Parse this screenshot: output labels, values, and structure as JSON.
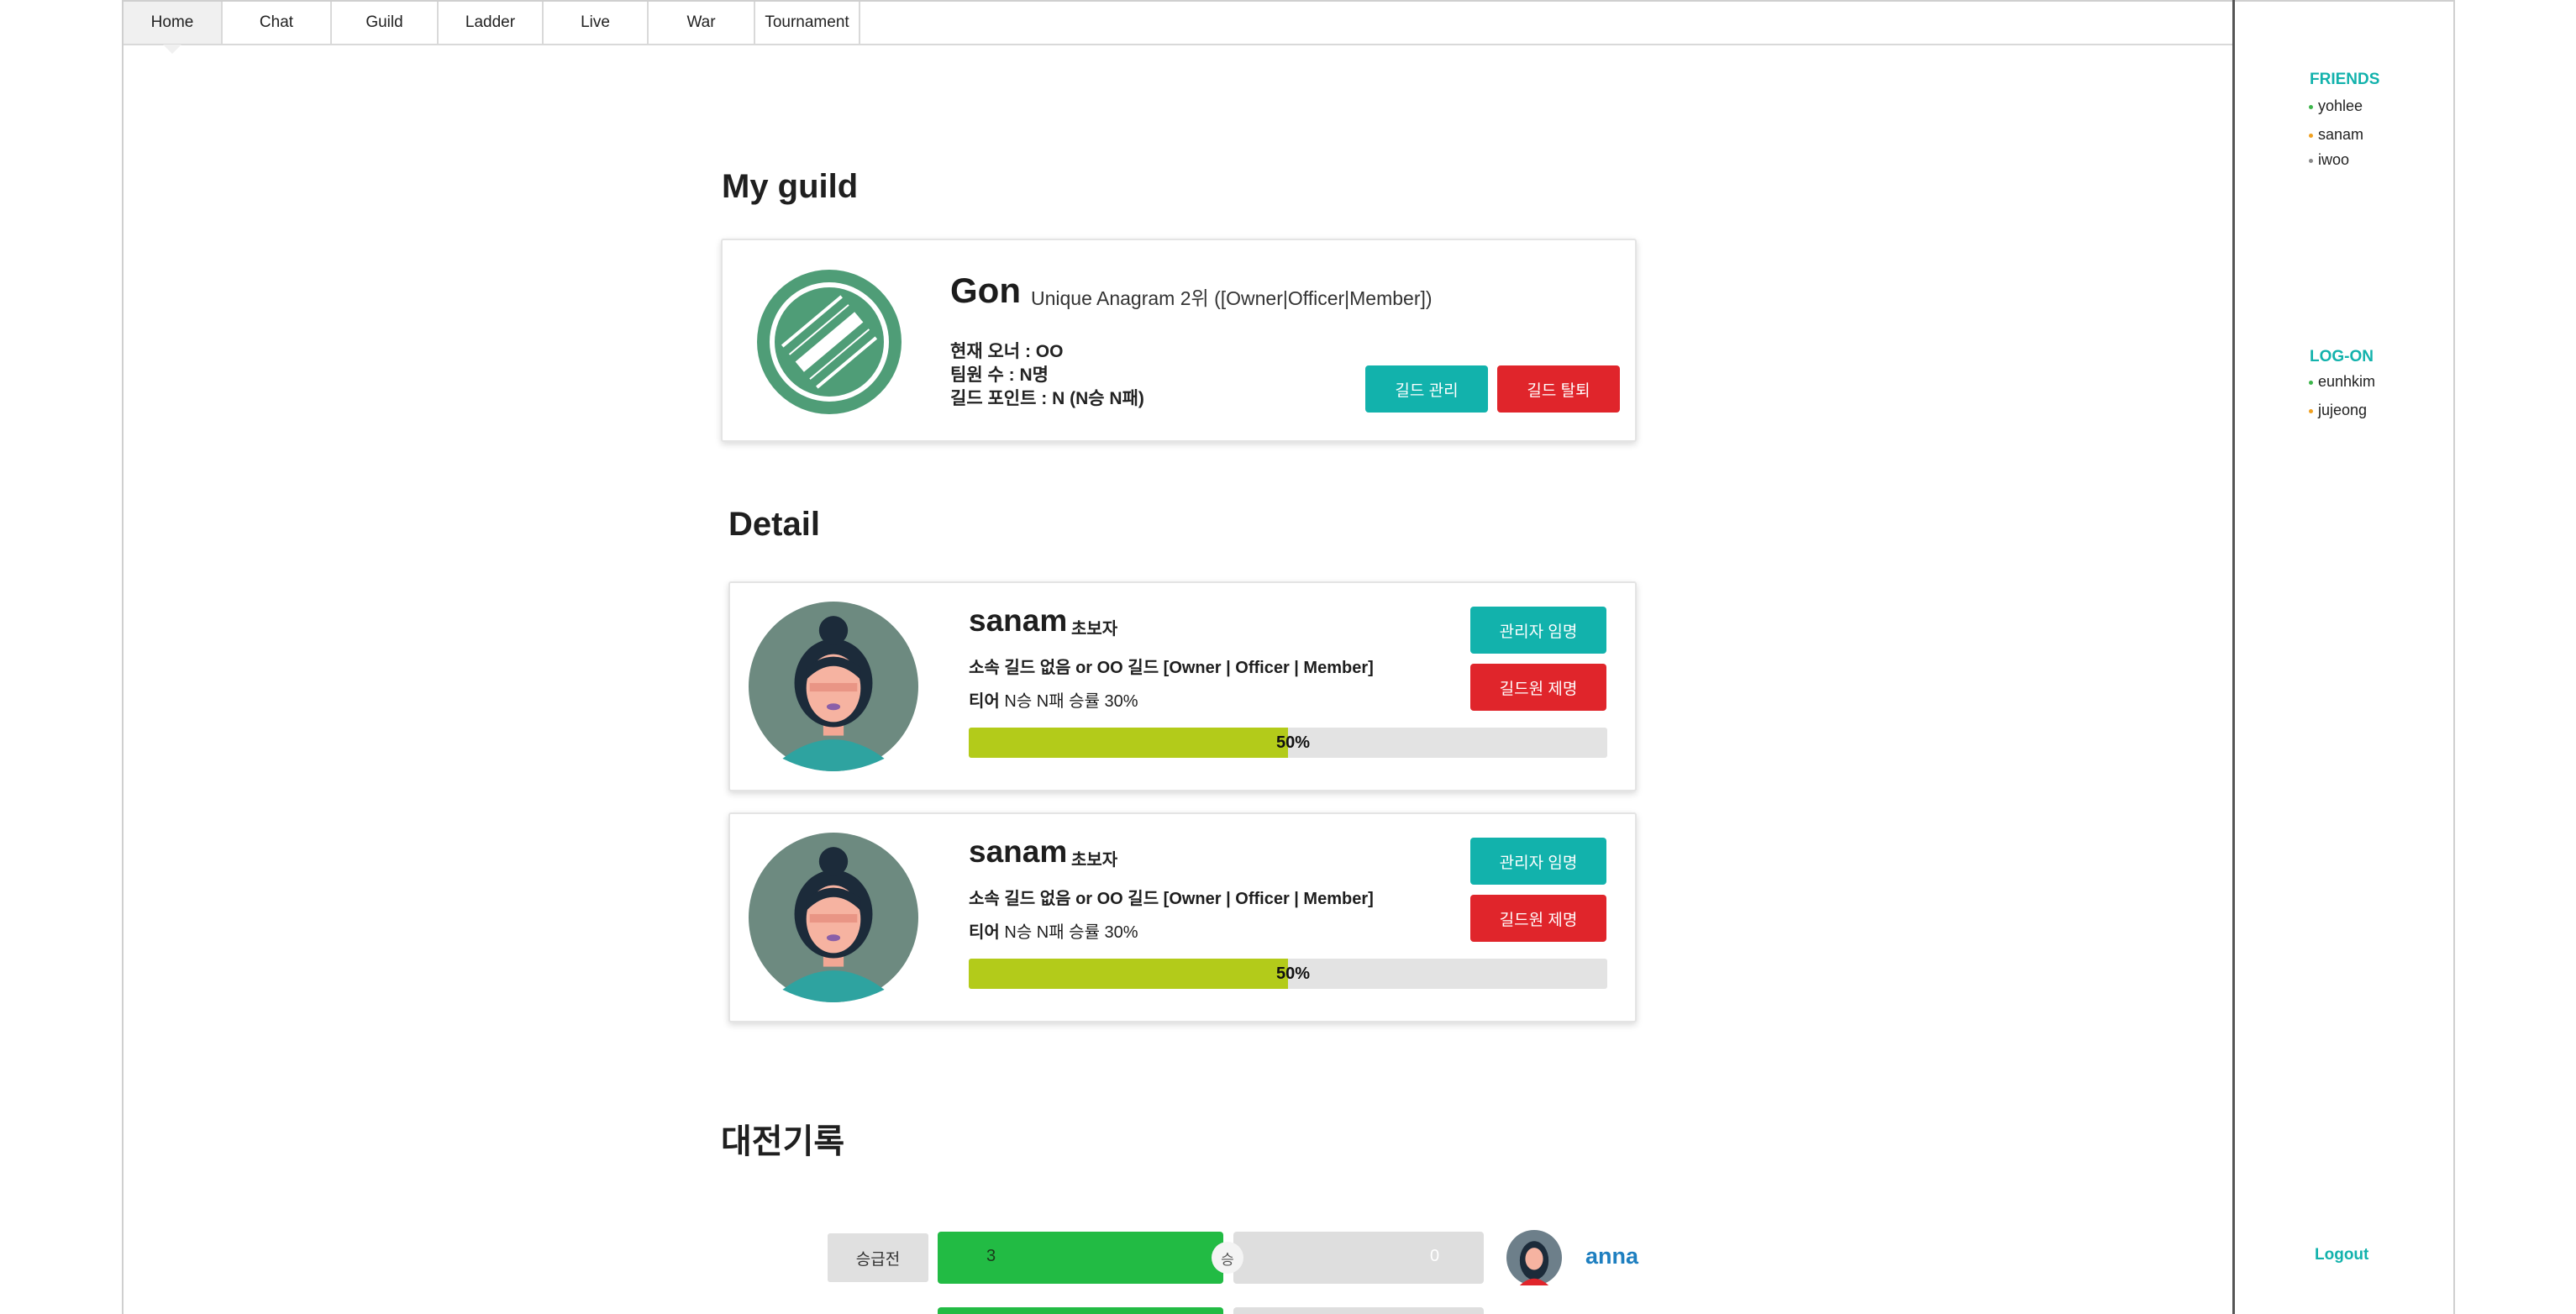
{
  "nav": [
    {
      "label": "Home"
    },
    {
      "label": "Chat"
    },
    {
      "label": "Guild"
    },
    {
      "label": "Ladder"
    },
    {
      "label": "Live"
    },
    {
      "label": "War"
    },
    {
      "label": "Tournament"
    }
  ],
  "guild": {
    "section_title": "My guild",
    "name": "Gon",
    "subtitle": "Unique Anagram 2위 ([Owner|Officer|Member])",
    "owner": "현재 오너 : OO",
    "members": "팀원 수 : N명",
    "points": "길드 포인트 : N (N승 N패)",
    "manage_label": "길드 관리",
    "leave_label": "길드 탈퇴",
    "logo_color": "#4f9d77"
  },
  "detail": {
    "section_title": "Detail",
    "members": [
      {
        "name": "sanam",
        "rank": "초보자",
        "guild_line": "소속 길드 없음 or OO 길드 [Owner | Officer | Member]",
        "tier_label": "티어",
        "tier_stats": "N승 N패 승률 30%",
        "progress": 0.5,
        "progress_label": "50%",
        "appoint_label": "관리자 임명",
        "kick_label": "길드원 제명"
      },
      {
        "name": "sanam",
        "rank": "초보자",
        "guild_line": "소속 길드 없음 or OO 길드 [Owner | Officer | Member]",
        "tier_label": "티어",
        "tier_stats": "N승 N패 승률 30%",
        "progress": 0.5,
        "progress_label": "50%",
        "appoint_label": "관리자 임명",
        "kick_label": "길드원 제명"
      }
    ]
  },
  "history": {
    "section_title": "대전기록",
    "rows": [
      {
        "type": "승급전",
        "left_score": "3",
        "right_score": "0",
        "result": "승",
        "opponent": "anna"
      }
    ]
  },
  "sidebar": {
    "friends_title": "FRIENDS",
    "friends": [
      {
        "name": "yohlee",
        "status_color": "#3cb54a"
      },
      {
        "name": "sanam",
        "status_color": "#f0a020"
      },
      {
        "name": "iwoo",
        "status_color": "#888888"
      }
    ],
    "logon_title": "LOG-ON",
    "logon": [
      {
        "name": "eunhkim",
        "status_color": "#3cb54a"
      },
      {
        "name": "jujeong",
        "status_color": "#f0a020"
      }
    ],
    "logout_label": "Logout"
  },
  "colors": {
    "accent": "#12b2ac",
    "danger": "#e0252b",
    "progress": "#b3cb1a",
    "win": "#22bb44"
  }
}
